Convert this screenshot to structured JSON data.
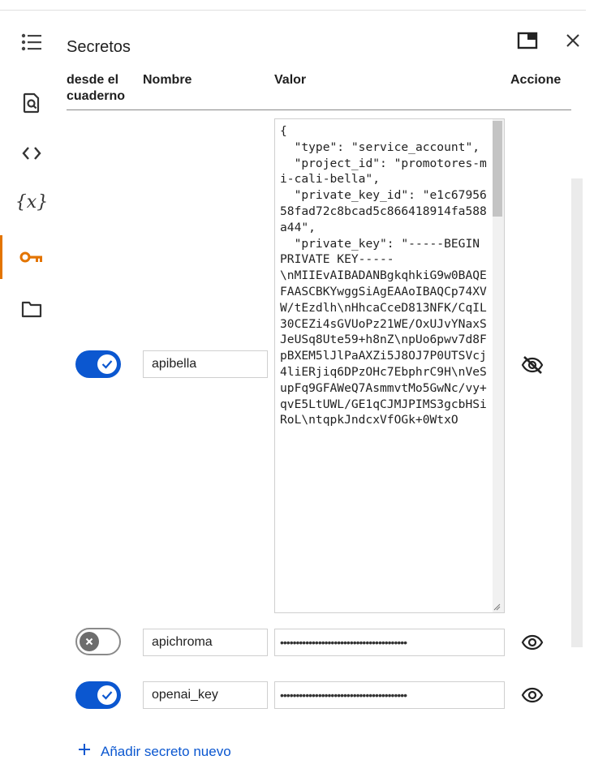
{
  "panel": {
    "title": "Secretos"
  },
  "table": {
    "headers": {
      "notebook_access": "desde el\ncuaderno",
      "name": "Nombre",
      "value": "Valor",
      "actions": "Accione"
    },
    "rows": [
      {
        "access_enabled": true,
        "name": "apibella",
        "value_visible": true,
        "value": "{\n  \"type\": \"service_account\",\n  \"project_id\": \"promotores-mi-cali-bella\",\n  \"private_key_id\": \"e1c6795658fad72c8bcad5c866418914fa588a44\",\n  \"private_key\": \"-----BEGIN PRIVATE KEY-----\n\\nMIIEvAIBADANBgkqhkiG9w0BAQEFAASCBKYwggSiAgEAAoIBAQCp74XVW/tEzdlh\\nHhcaCceD813NFK/CqIL30CEZi4sGVUoPz21WE/OxUJvYNaxSJeUSq8Ute59+h8nZ\\npUo6pwv7d8FpBXEM5lJlPaAXZi5J8OJ7P0UTSVcj4liERjiq6DPzOHc7EbphrC9H\\nVeSupFq9GFAWeQ7AsmmvtMo5GwNc/vy+qvE5LtUWL/GE1qCJMJPIMS3gcbHSiRoL\\ntqpkJndcxVfOGk+0WtxO",
        "action_icon": "visibility-off-icon"
      },
      {
        "access_enabled": false,
        "name": "apichroma",
        "value_visible": false,
        "value": "••••••••••••••••••••••••••••••••••••••••",
        "action_icon": "visibility-icon"
      },
      {
        "access_enabled": true,
        "name": "openai_key",
        "value_visible": false,
        "value": "••••••••••••••••••••••••••••••••••••••••",
        "action_icon": "visibility-icon"
      }
    ]
  },
  "add_secret": {
    "label": "Añadir secreto nuevo"
  },
  "colors": {
    "accent": "#0b57d0",
    "active_rail": "#e37400"
  }
}
